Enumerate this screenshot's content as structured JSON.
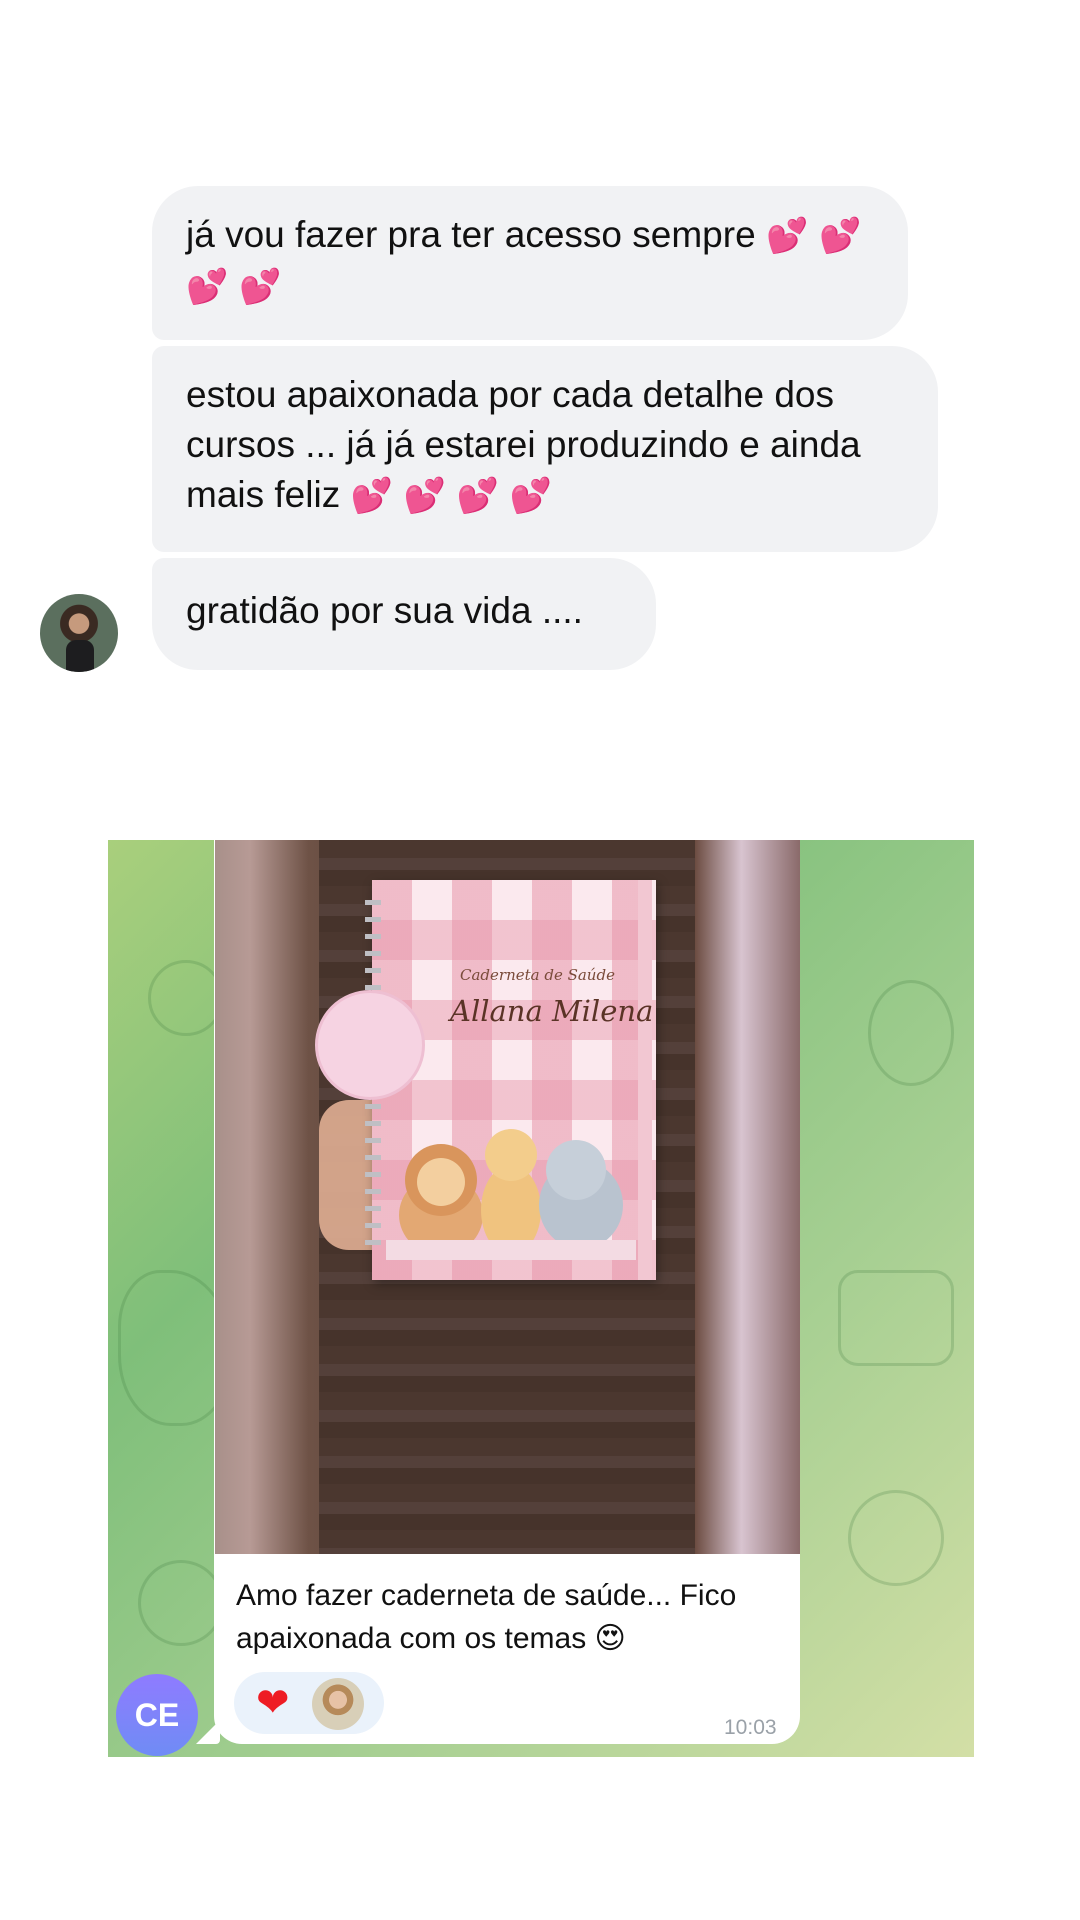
{
  "messenger": {
    "messages": [
      {
        "text": "já vou fazer pra ter acesso sempre",
        "emojis": "💕 💕 💕 💕"
      },
      {
        "text": "estou apaixonada por cada detalhe dos cursos ... já já estarei produzindo e ainda mais feliz",
        "emojis": "💕 💕 💕 💕"
      },
      {
        "text": "gratidão por sua vida ...."
      }
    ]
  },
  "telegram": {
    "video_notebook": {
      "label_small": "Caderneta de Saúde",
      "label_name": "Allana Milena"
    },
    "caption": "Amo fazer caderneta de saúde... Fico apaixonada com os temas 😍",
    "reaction_icon": "heart",
    "reaction_emoji": "❤",
    "time": "10:03",
    "sender_initials": "CE",
    "accent_color": "#7b86f7"
  }
}
